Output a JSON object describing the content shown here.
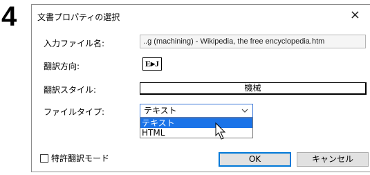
{
  "step_number": "4",
  "dialog": {
    "title": "文書プロパティの選択",
    "close_glyph": "×",
    "input_file_label": "入力ファイル名:",
    "input_file_value": "..g (machining) - Wikipedia, the free encyclopedia.htm",
    "direction_label": "翻訳方向:",
    "direction_value": "E▸J",
    "style_label": "翻訳スタイル:",
    "style_value": "機械",
    "filetype_label": "ファイルタイプ:",
    "filetype_selected": "テキスト",
    "filetype_options": [
      "テキスト",
      "HTML"
    ],
    "patent_mode_label": "特許翻訳モード",
    "patent_mode_checked": false,
    "ok_label": "OK",
    "cancel_label": "キャンセル"
  },
  "icons": {
    "close": "close-icon",
    "chevron": "chevron-down-icon",
    "cursor": "mouse-pointer-icon"
  },
  "colors": {
    "selection": "#1a73e8",
    "focus_border": "#0078d7"
  }
}
